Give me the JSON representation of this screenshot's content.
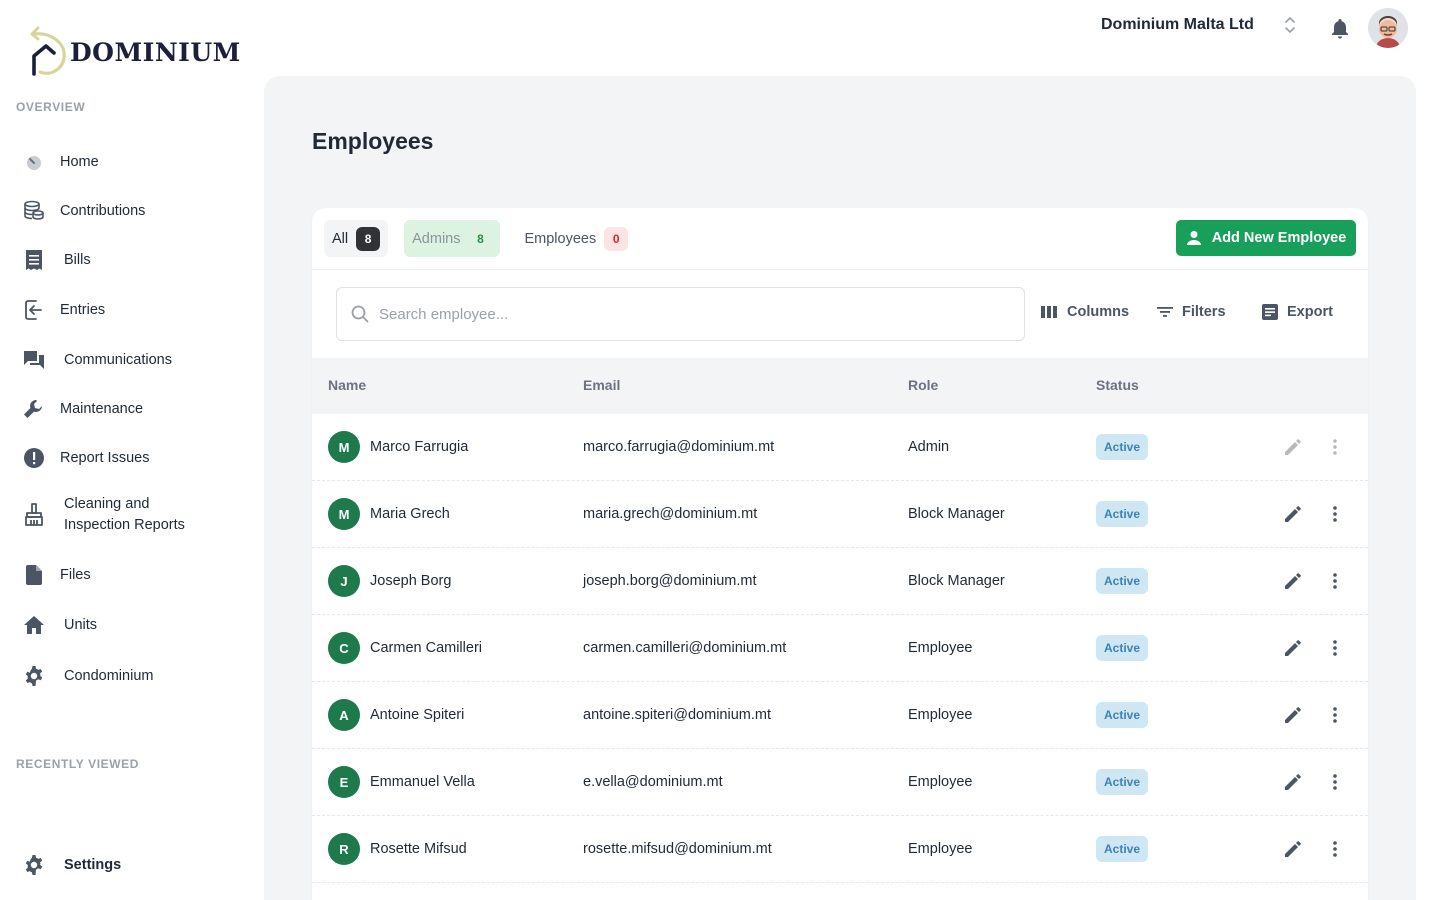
{
  "brand": {
    "name": "Dominium"
  },
  "topbar": {
    "org_name": "Dominium Malta Ltd"
  },
  "sidebar": {
    "overview_label": "OVERVIEW",
    "items": [
      {
        "label": "Home",
        "icon": "gauge-icon"
      },
      {
        "label": "Contributions",
        "icon": "coins-icon"
      },
      {
        "label": "Bills",
        "icon": "receipt-icon"
      },
      {
        "label": "Entries",
        "icon": "login-icon"
      },
      {
        "label": "Communications",
        "icon": "chat-icon"
      },
      {
        "label": "Maintenance",
        "icon": "wrench-icon"
      },
      {
        "label": "Report Issues",
        "icon": "alert-icon"
      },
      {
        "label": "Cleaning and\nInspection Reports",
        "line1": "Cleaning and",
        "line2": "Inspection Reports",
        "icon": "broom-icon"
      },
      {
        "label": "Files",
        "icon": "file-icon"
      },
      {
        "label": "Units",
        "icon": "house-icon"
      },
      {
        "label": "Condominium",
        "icon": "gear-icon"
      }
    ],
    "recent_label": "RECENTLY VIEWED",
    "settings_label": "Settings"
  },
  "page": {
    "title": "Employees",
    "tabs": [
      {
        "label": "All",
        "count": "8"
      },
      {
        "label": "Admins",
        "count": "8"
      },
      {
        "label": "Employees",
        "count": "0"
      }
    ],
    "add_button": "Add New Employee",
    "search_placeholder": "Search employee...",
    "tools": {
      "columns": "Columns",
      "filters": "Filters",
      "export": "Export"
    },
    "table": {
      "headers": {
        "name": "Name",
        "email": "Email",
        "role": "Role",
        "status": "Status"
      },
      "rows": [
        {
          "initial": "M",
          "name": "Marco Farrugia",
          "email": "marco.farrugia@dominium.mt",
          "role": "Admin",
          "status": "Active"
        },
        {
          "initial": "M",
          "name": "Maria Grech",
          "email": "maria.grech@dominium.mt",
          "role": "Block Manager",
          "status": "Active"
        },
        {
          "initial": "J",
          "name": "Joseph Borg",
          "email": "joseph.borg@dominium.mt",
          "role": "Block Manager",
          "status": "Active"
        },
        {
          "initial": "C",
          "name": "Carmen Camilleri",
          "email": "carmen.camilleri@dominium.mt",
          "role": "Employee",
          "status": "Active"
        },
        {
          "initial": "A",
          "name": "Antoine Spiteri",
          "email": "antoine.spiteri@dominium.mt",
          "role": "Employee",
          "status": "Active"
        },
        {
          "initial": "E",
          "name": "Emmanuel Vella",
          "email": "e.vella@dominium.mt",
          "role": "Employee",
          "status": "Active"
        },
        {
          "initial": "R",
          "name": "Rosette Mifsud",
          "email": "rosette.mifsud@dominium.mt",
          "role": "Employee",
          "status": "Active"
        }
      ]
    }
  },
  "colors": {
    "accent_green": "#18a05a",
    "avatar_green": "#1f7a4b",
    "badge_bg": "#cfe7f3",
    "badge_text": "#3b82b6",
    "logo_gold": "#d8d59a",
    "logo_navy": "#1b1f3b"
  }
}
